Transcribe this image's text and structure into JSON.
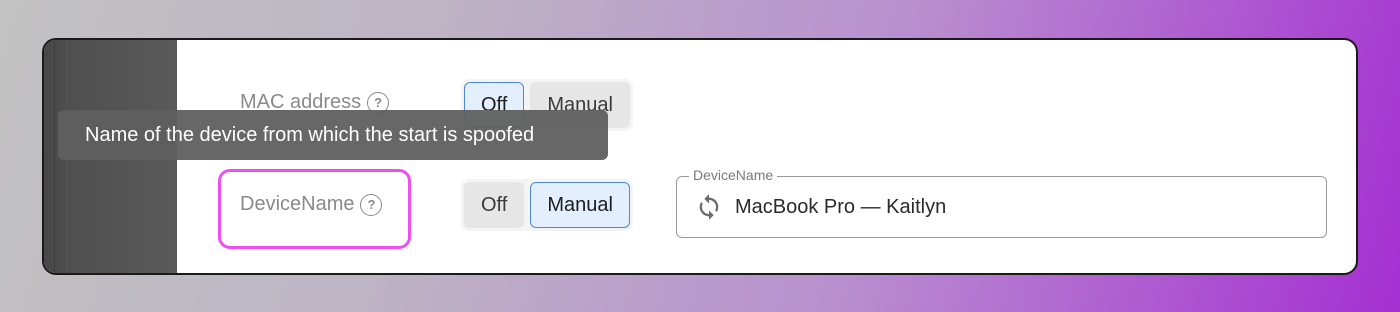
{
  "settings": {
    "mac_address": {
      "label": "MAC address",
      "help": "?",
      "options": [
        "Off",
        "Manual"
      ],
      "selected": "Off"
    },
    "device_name": {
      "label": "DeviceName",
      "help": "?",
      "options": [
        "Off",
        "Manual"
      ],
      "selected": "Manual",
      "field_label": "DeviceName",
      "value": "MacBook Pro — Kaitlyn"
    }
  },
  "tooltip": {
    "text": "Name of the device from which the start is spoofed"
  },
  "icons": {
    "help": "question-circle-icon",
    "refresh": "refresh-icon"
  },
  "colors": {
    "highlight": "#ee4ef2",
    "active_border": "#4b8ad6",
    "active_bg": "#e3effc"
  }
}
